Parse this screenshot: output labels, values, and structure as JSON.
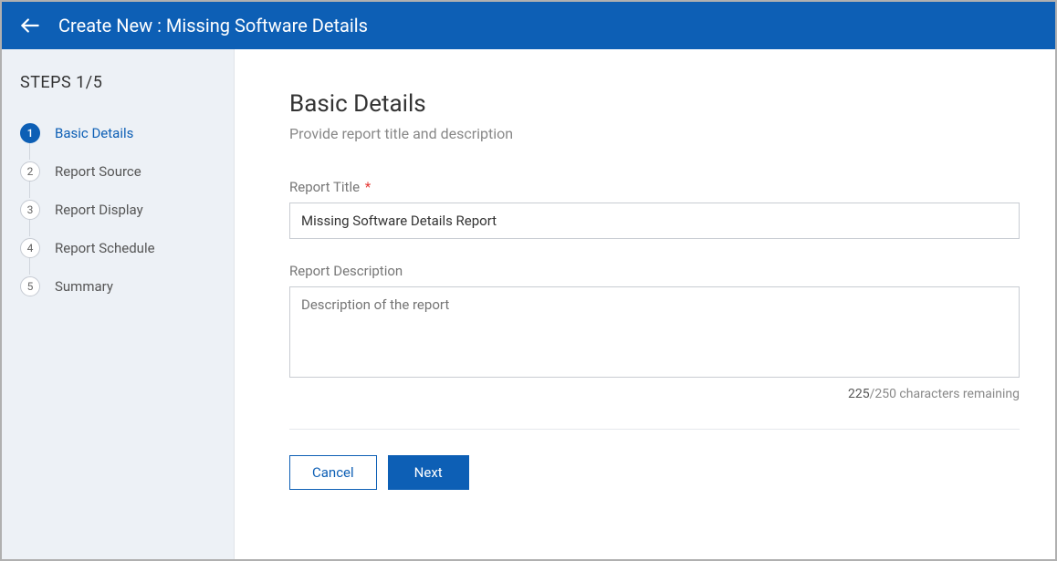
{
  "header": {
    "title": "Create New : Missing Software Details"
  },
  "sidebar": {
    "steps_label": "STEPS 1/5",
    "steps": [
      {
        "num": "1",
        "label": "Basic Details"
      },
      {
        "num": "2",
        "label": "Report Source"
      },
      {
        "num": "3",
        "label": "Report Display"
      },
      {
        "num": "4",
        "label": "Report Schedule"
      },
      {
        "num": "5",
        "label": "Summary"
      }
    ]
  },
  "content": {
    "title": "Basic Details",
    "subtitle": "Provide report title and description",
    "report_title_label": "Report Title",
    "report_title_value": "Missing Software Details Report",
    "report_desc_label": "Report Description",
    "report_desc_placeholder": "Description of the report",
    "char_used": "225",
    "char_remaining_text": "/250 characters remaining"
  },
  "actions": {
    "cancel": "Cancel",
    "next": "Next"
  }
}
